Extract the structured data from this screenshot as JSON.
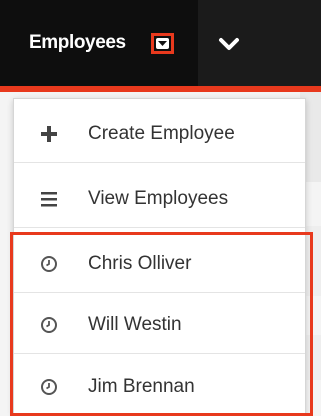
{
  "navbar": {
    "module_label": "Employees",
    "colors": {
      "bar": "#1b1b1b",
      "accent": "#e8391d"
    },
    "icons": {
      "dropdown": "caret-down-icon",
      "more": "chevron-down-icon"
    }
  },
  "menu": {
    "items": [
      {
        "label": "Create Employee",
        "icon": "plus-icon"
      },
      {
        "label": "View Employees",
        "icon": "list-icon"
      }
    ],
    "recently_viewed": [
      {
        "label": "Chris Olliver",
        "icon": "clock-icon"
      },
      {
        "label": "Will Westin",
        "icon": "clock-icon"
      },
      {
        "label": "Jim Brennan",
        "icon": "clock-icon"
      }
    ]
  }
}
